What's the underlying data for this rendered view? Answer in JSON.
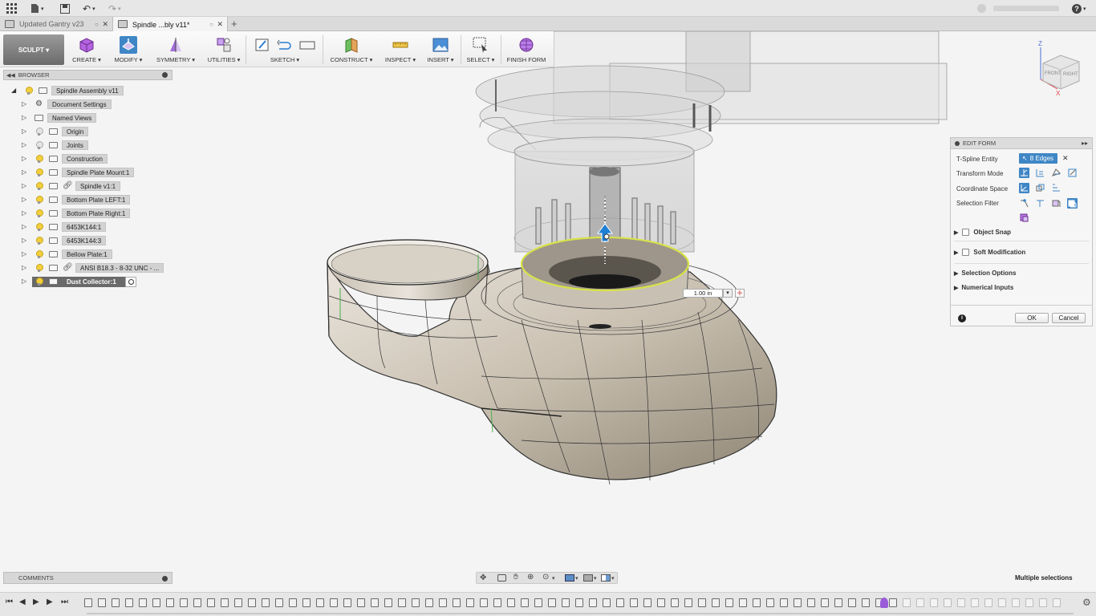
{
  "tabs": [
    {
      "label": "Updated Gantry v23",
      "active": false
    },
    {
      "label": "Spindle ...bly v11*",
      "active": true
    }
  ],
  "toolbar": {
    "workspace": "SCULPT",
    "groups": [
      "CREATE",
      "MODIFY",
      "SYMMETRY",
      "UTILITIES",
      "SKETCH",
      "CONSTRUCT",
      "INSPECT",
      "INSERT",
      "SELECT",
      "FINISH FORM"
    ]
  },
  "browser": {
    "title": "BROWSER",
    "items": [
      {
        "label": "Spindle Assembly v11",
        "light": true
      },
      {
        "label": "Document Settings",
        "light": null
      },
      {
        "label": "Named Views",
        "light": null
      },
      {
        "label": "Origin",
        "light": false
      },
      {
        "label": "Joints",
        "light": false
      },
      {
        "label": "Construction",
        "light": true
      },
      {
        "label": "Spindle Plate Mount:1",
        "light": true
      },
      {
        "label": "Spindle v1:1",
        "light": true
      },
      {
        "label": "Bottom Plate LEFT:1",
        "light": true
      },
      {
        "label": "Bottom Plate Right:1",
        "light": true
      },
      {
        "label": "6453K144:1",
        "light": true
      },
      {
        "label": "6453K144:3",
        "light": true
      },
      {
        "label": "Bellow Plate:1",
        "light": true
      },
      {
        "label": "ANSI B18.3 - 8-32 UNC - ...",
        "light": true
      },
      {
        "label": "Dust Collector:1",
        "light": true
      }
    ]
  },
  "edit_form": {
    "title": "EDIT FORM",
    "tspline_entity_label": "T-Spline Entity",
    "tspline_entity_value": "8 Edges",
    "transform_mode_label": "Transform Mode",
    "coordinate_space_label": "Coordinate Space",
    "selection_filter_label": "Selection Filter",
    "object_snap": "Object Snap",
    "soft_modification": "Soft Modification",
    "selection_options": "Selection Options",
    "numerical_inputs": "Numerical Inputs",
    "ok": "OK",
    "cancel": "Cancel"
  },
  "viewport": {
    "distance_value": "1.00 in",
    "view_cube_face": "RIGHT",
    "view_cube_face_top": "FRONT"
  },
  "comments": {
    "title": "COMMENTS"
  },
  "status": {
    "selection_text": "Multiple selections"
  },
  "colors": {
    "accent": "#3f86c6",
    "selected_edge": "#d8e24a",
    "body": "#c9c0b2"
  }
}
